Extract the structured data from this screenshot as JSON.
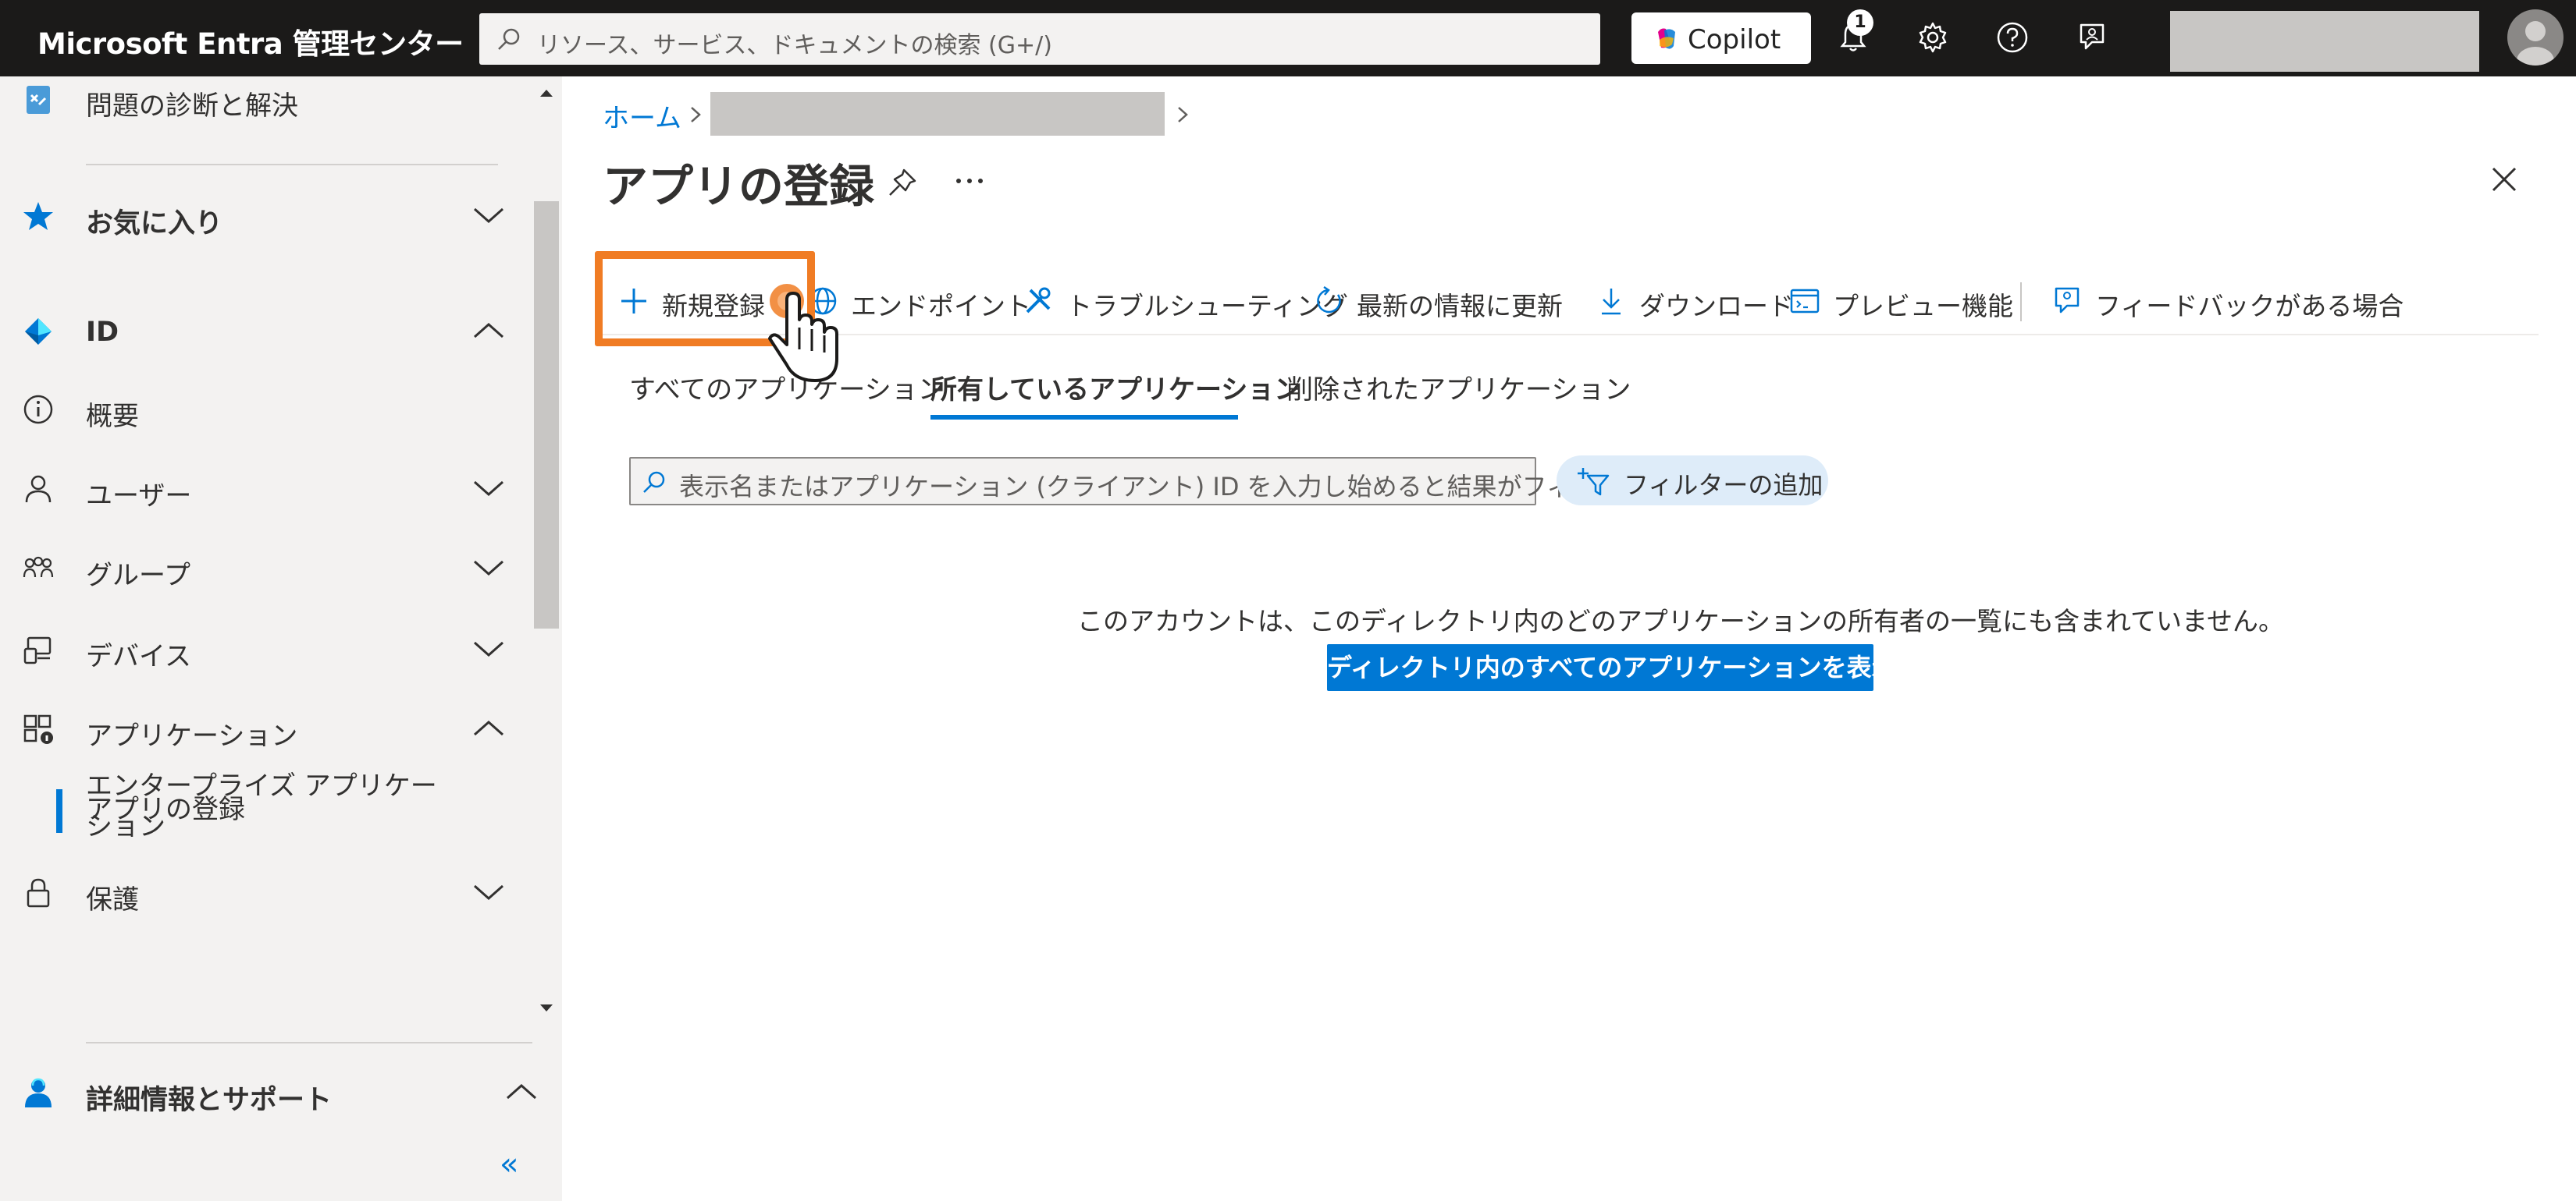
{
  "header": {
    "brand": "Microsoft Entra 管理センター",
    "search_placeholder": "リソース、サービス、ドキュメントの検索 (G+/)",
    "copilot_label": "Copilot",
    "notification_count": "1",
    "icons": [
      "bell-icon",
      "gear-icon",
      "help-icon",
      "feedback-icon"
    ]
  },
  "sidebar": {
    "items": [
      {
        "label": "問題の診断と解決",
        "icon": "diagnose-icon"
      },
      {
        "label": "お気に入り",
        "icon": "star-icon",
        "expanded": false
      },
      {
        "label": "ID",
        "icon": "identity-icon",
        "expanded": true
      },
      {
        "label": "概要",
        "icon": "info-icon"
      },
      {
        "label": "ユーザー",
        "icon": "user-icon",
        "expanded": false
      },
      {
        "label": "グループ",
        "icon": "group-icon",
        "expanded": false
      },
      {
        "label": "デバイス",
        "icon": "device-icon",
        "expanded": false
      },
      {
        "label": "アプリケーション",
        "icon": "applications-icon",
        "expanded": true
      },
      {
        "label": "保護",
        "icon": "lock-icon",
        "expanded": false
      },
      {
        "label": "詳細情報とサポート",
        "icon": "support-icon",
        "expanded": true
      }
    ],
    "sub_items": [
      {
        "label_line1": "エンタープライズ アプリケー",
        "label_line2": "ション"
      },
      {
        "label": "アプリの登録",
        "active": true
      }
    ],
    "collapse_label": "«"
  },
  "breadcrumb": {
    "home": "ホーム"
  },
  "page": {
    "title": "アプリの登録"
  },
  "commands": [
    {
      "label": "新規登録",
      "icon": "plus-icon"
    },
    {
      "label": "エンドポイント",
      "icon": "globe-icon"
    },
    {
      "label": "トラブルシューティング",
      "icon": "wrench-icon"
    },
    {
      "label": "最新の情報に更新",
      "icon": "refresh-icon"
    },
    {
      "label": "ダウンロード",
      "icon": "download-icon"
    },
    {
      "label": "プレビュー機能",
      "icon": "preview-icon"
    },
    {
      "label": "フィードバックがある場合",
      "icon": "feedback-icon"
    }
  ],
  "tabs": [
    {
      "label": "すべてのアプリケーション",
      "active": false
    },
    {
      "label": "所有しているアプリケーション",
      "active": true
    },
    {
      "label": "削除されたアプリケーション",
      "active": false
    }
  ],
  "filter": {
    "placeholder": "表示名またはアプリケーション (クライアント) ID を入力し始めると結果がフィ…",
    "add_filter_label": "フィルターの追加"
  },
  "empty_state": {
    "message": "このアカウントは、このディレクトリ内のどのアプリケーションの所有者の一覧にも含まれていません。",
    "button_label": "ディレクトリ内のすべてのアプリケーションを表示"
  },
  "colors": {
    "accent": "#0078d4",
    "highlight": "#f07c24",
    "topbar": "#1b1a19",
    "sidebar_bg": "#f3f2f1"
  }
}
